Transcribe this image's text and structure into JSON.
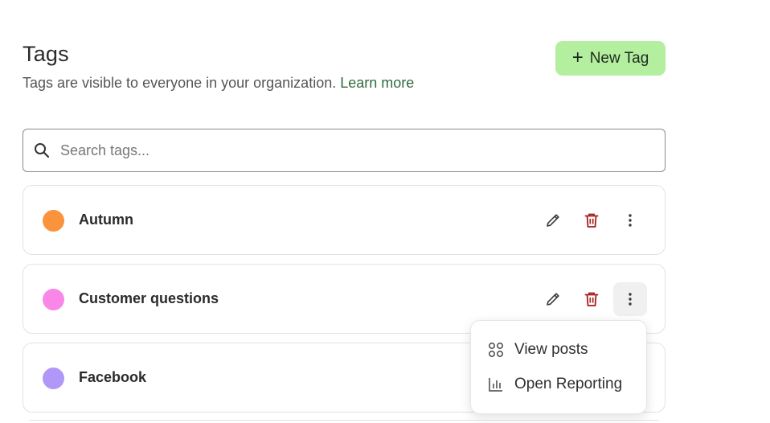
{
  "header": {
    "title": "Tags",
    "subtitle": "Tags are visible to everyone in your organization.",
    "learn_more": "Learn more",
    "new_tag_plus": "+",
    "new_tag_label": "New Tag"
  },
  "search": {
    "placeholder": "Search tags...",
    "value": ""
  },
  "tags": [
    {
      "name": "Autumn",
      "color": "#fb923c"
    },
    {
      "name": "Customer questions",
      "color": "#f987e8"
    },
    {
      "name": "Facebook",
      "color": "#b197f8"
    }
  ],
  "menu": {
    "view_posts": "View posts",
    "open_reporting": "Open Reporting"
  },
  "colors": {
    "accent_button": "#b4ee9f",
    "link": "#2f6b3c",
    "delete": "#a61d1d"
  }
}
